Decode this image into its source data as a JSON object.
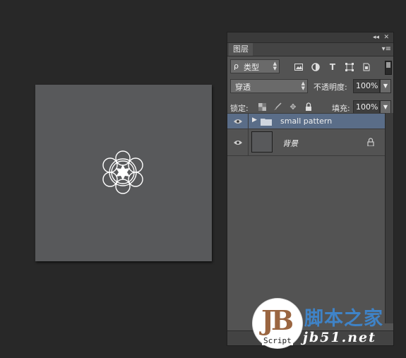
{
  "panel": {
    "collapse_symbol": "◂◂",
    "close_symbol": "✕",
    "tab_label": "图层",
    "menu_symbol": "▾≡",
    "filter": {
      "kind_label": "类型",
      "search_symbol": "ρ"
    },
    "blend": {
      "mode": "穿透",
      "opacity_label": "不透明度:",
      "opacity_value": "100%"
    },
    "lock": {
      "label": "锁定:",
      "fill_label": "填充:",
      "fill_value": "100%"
    },
    "layers": [
      {
        "name": "small pattern",
        "type": "group",
        "selected": true
      },
      {
        "name": "背景",
        "type": "background",
        "locked": true
      }
    ]
  },
  "watermark": {
    "logo_letters": "JB",
    "script_label": "Script",
    "site_name": "脚本之家",
    "url": "jb51.net"
  },
  "colors": {
    "app_bg": "#282828",
    "panel_bg": "#535353",
    "selected_layer": "#5a6d88",
    "canvas": "#58595b",
    "watermark_blue": "#3f83c7",
    "watermark_brown": "#9a6540"
  }
}
